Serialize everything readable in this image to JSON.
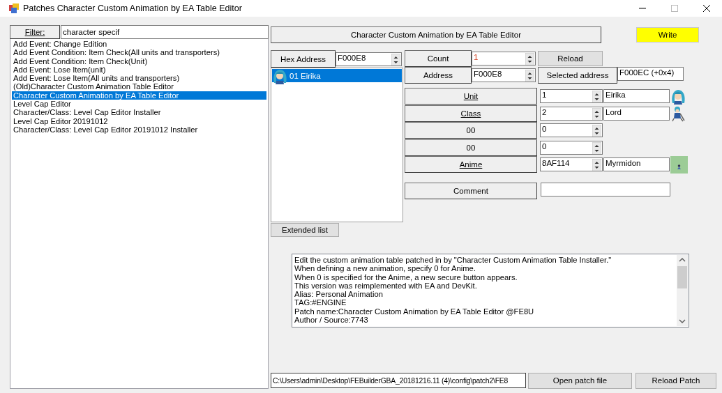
{
  "window": {
    "title": "Patches Character Custom Animation by EA Table Editor"
  },
  "filter": {
    "label": "Filter:",
    "value": "character specif"
  },
  "patch_list": [
    {
      "label": "Add Event: Change Edition",
      "selected": false
    },
    {
      "label": "Add Event Condition: Item Check(All units and transporters)",
      "selected": false
    },
    {
      "label": "Add Event Condition: Item Check(Unit)",
      "selected": false
    },
    {
      "label": "Add Event: Lose Item(unit)",
      "selected": false
    },
    {
      "label": "Add Event: Lose Item(All units and transporters)",
      "selected": false
    },
    {
      "label": "(Old)Character Custom Animation Table Editor",
      "selected": false
    },
    {
      "label": "Character Custom Animation by EA Table Editor",
      "selected": true
    },
    {
      "label": "Level Cap Editor",
      "selected": false
    },
    {
      "label": "Character/Class: Level Cap Editor Installer",
      "selected": false
    },
    {
      "label": "Level Cap Editor 20191012",
      "selected": false
    },
    {
      "label": "Character/Class: Level Cap Editor 20191012 Installer",
      "selected": false
    }
  ],
  "editor": {
    "title": "Character Custom Animation by EA Table Editor",
    "write_button": "Write",
    "hex_address": {
      "label": "Hex Address",
      "value": "F000E8"
    },
    "entries": [
      {
        "label": "01 Eirika",
        "selected": true
      }
    ],
    "extended_list_button": "Extended list",
    "count": {
      "label": "Count",
      "value": "1"
    },
    "reload_button": "Reload",
    "address": {
      "label": "Address",
      "value": "F000E8"
    },
    "selected_address": {
      "label": "Selected address",
      "value": "F000EC (+0x4)"
    },
    "fields": [
      {
        "kind": "unit",
        "label": "Unit",
        "value": "1",
        "name": "Eirika"
      },
      {
        "kind": "class",
        "label": "Class",
        "value": "2",
        "name": "Lord"
      },
      {
        "kind": "plain",
        "label": "00",
        "value": "0"
      },
      {
        "kind": "plain",
        "label": "00",
        "value": "0"
      },
      {
        "kind": "anime",
        "label": "Anime",
        "value": "8AF114",
        "name": "Myrmidon"
      }
    ],
    "comment": {
      "label": "Comment"
    },
    "description": [
      "Edit the custom animation table patched in by \"Character Custom Animation Table Installer.\"",
      "When defining a new animation, specify 0 for Anime.",
      "When 0 is specified for the Anime, a new secure button appears.",
      "This version was reimplemented with EA and DevKit.",
      "Alias: Personal Animation",
      "TAG:#ENGINE",
      "Patch name:Character Custom Animation by EA Table Editor  @FE8U",
      "Author / Source:7743"
    ]
  },
  "footer": {
    "path": "C:\\Users\\admin\\Desktop\\FEBuilderGBA_20181216.11 (4)\\config\\patch2\\FE8",
    "open_button": "Open patch file",
    "reload_button": "Reload Patch"
  }
}
